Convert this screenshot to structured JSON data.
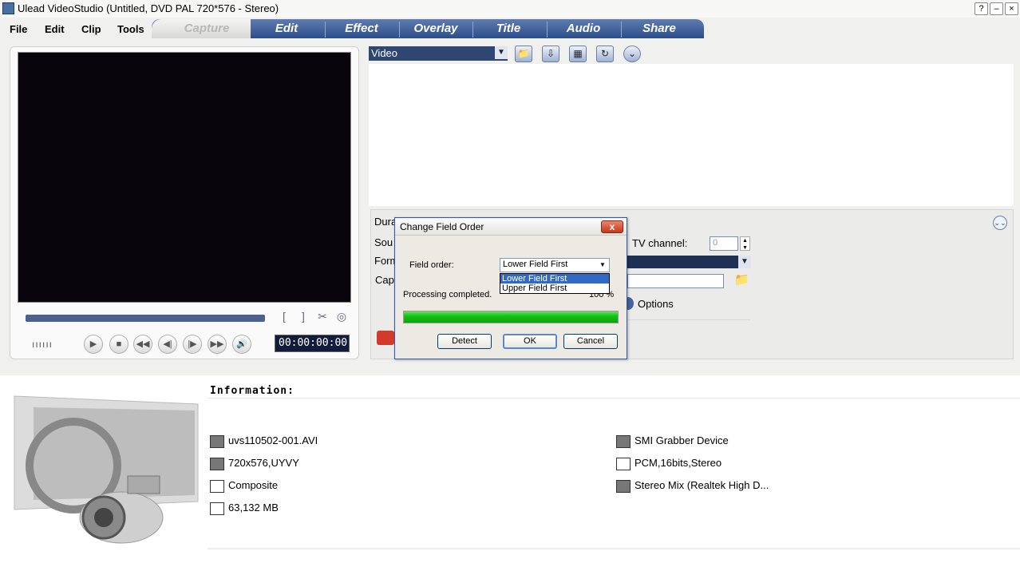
{
  "window": {
    "title": "Ulead VideoStudio (Untitled, DVD PAL 720*576 - Stereo)",
    "help": "?",
    "minimize": "–",
    "close": "×"
  },
  "menu": [
    "File",
    "Edit",
    "Clip",
    "Tools"
  ],
  "tabs": [
    "Capture",
    "Edit",
    "Effect",
    "Overlay",
    "Title",
    "Audio",
    "Share"
  ],
  "player": {
    "timecode": "00:00:00:00",
    "mark_in": "[",
    "mark_out": "]",
    "jog": "ıııııı"
  },
  "library": {
    "selected": "Video"
  },
  "options_panel": {
    "labels": [
      "Dura",
      "Sou",
      "Form",
      "Cap"
    ],
    "tv_channel_label": "TV channel:",
    "tv_channel_value": "0",
    "options_label": "Options"
  },
  "dialog": {
    "title": "Change Field Order",
    "close": "x",
    "field_order_label": "Field order:",
    "field_order_value": "Lower Field First",
    "options": [
      "Lower Field First",
      "Upper Field First"
    ],
    "status": "Processing completed.",
    "percent_text": "100 %",
    "progress": 1.0,
    "buttons": {
      "detect": "Detect",
      "ok": "OK",
      "cancel": "Cancel"
    }
  },
  "information": {
    "heading": "Information:",
    "left": [
      "uvs110502-001.AVI",
      "720x576,UYVY",
      "Composite",
      "63,132 MB"
    ],
    "right": [
      "SMI Grabber Device",
      "PCM,16bits,Stereo",
      "Stereo Mix (Realtek High D..."
    ]
  },
  "colors": {
    "tab_blue": "#2d4d8a",
    "progress_green": "#15c215",
    "timecode_bg": "#111c3a"
  }
}
